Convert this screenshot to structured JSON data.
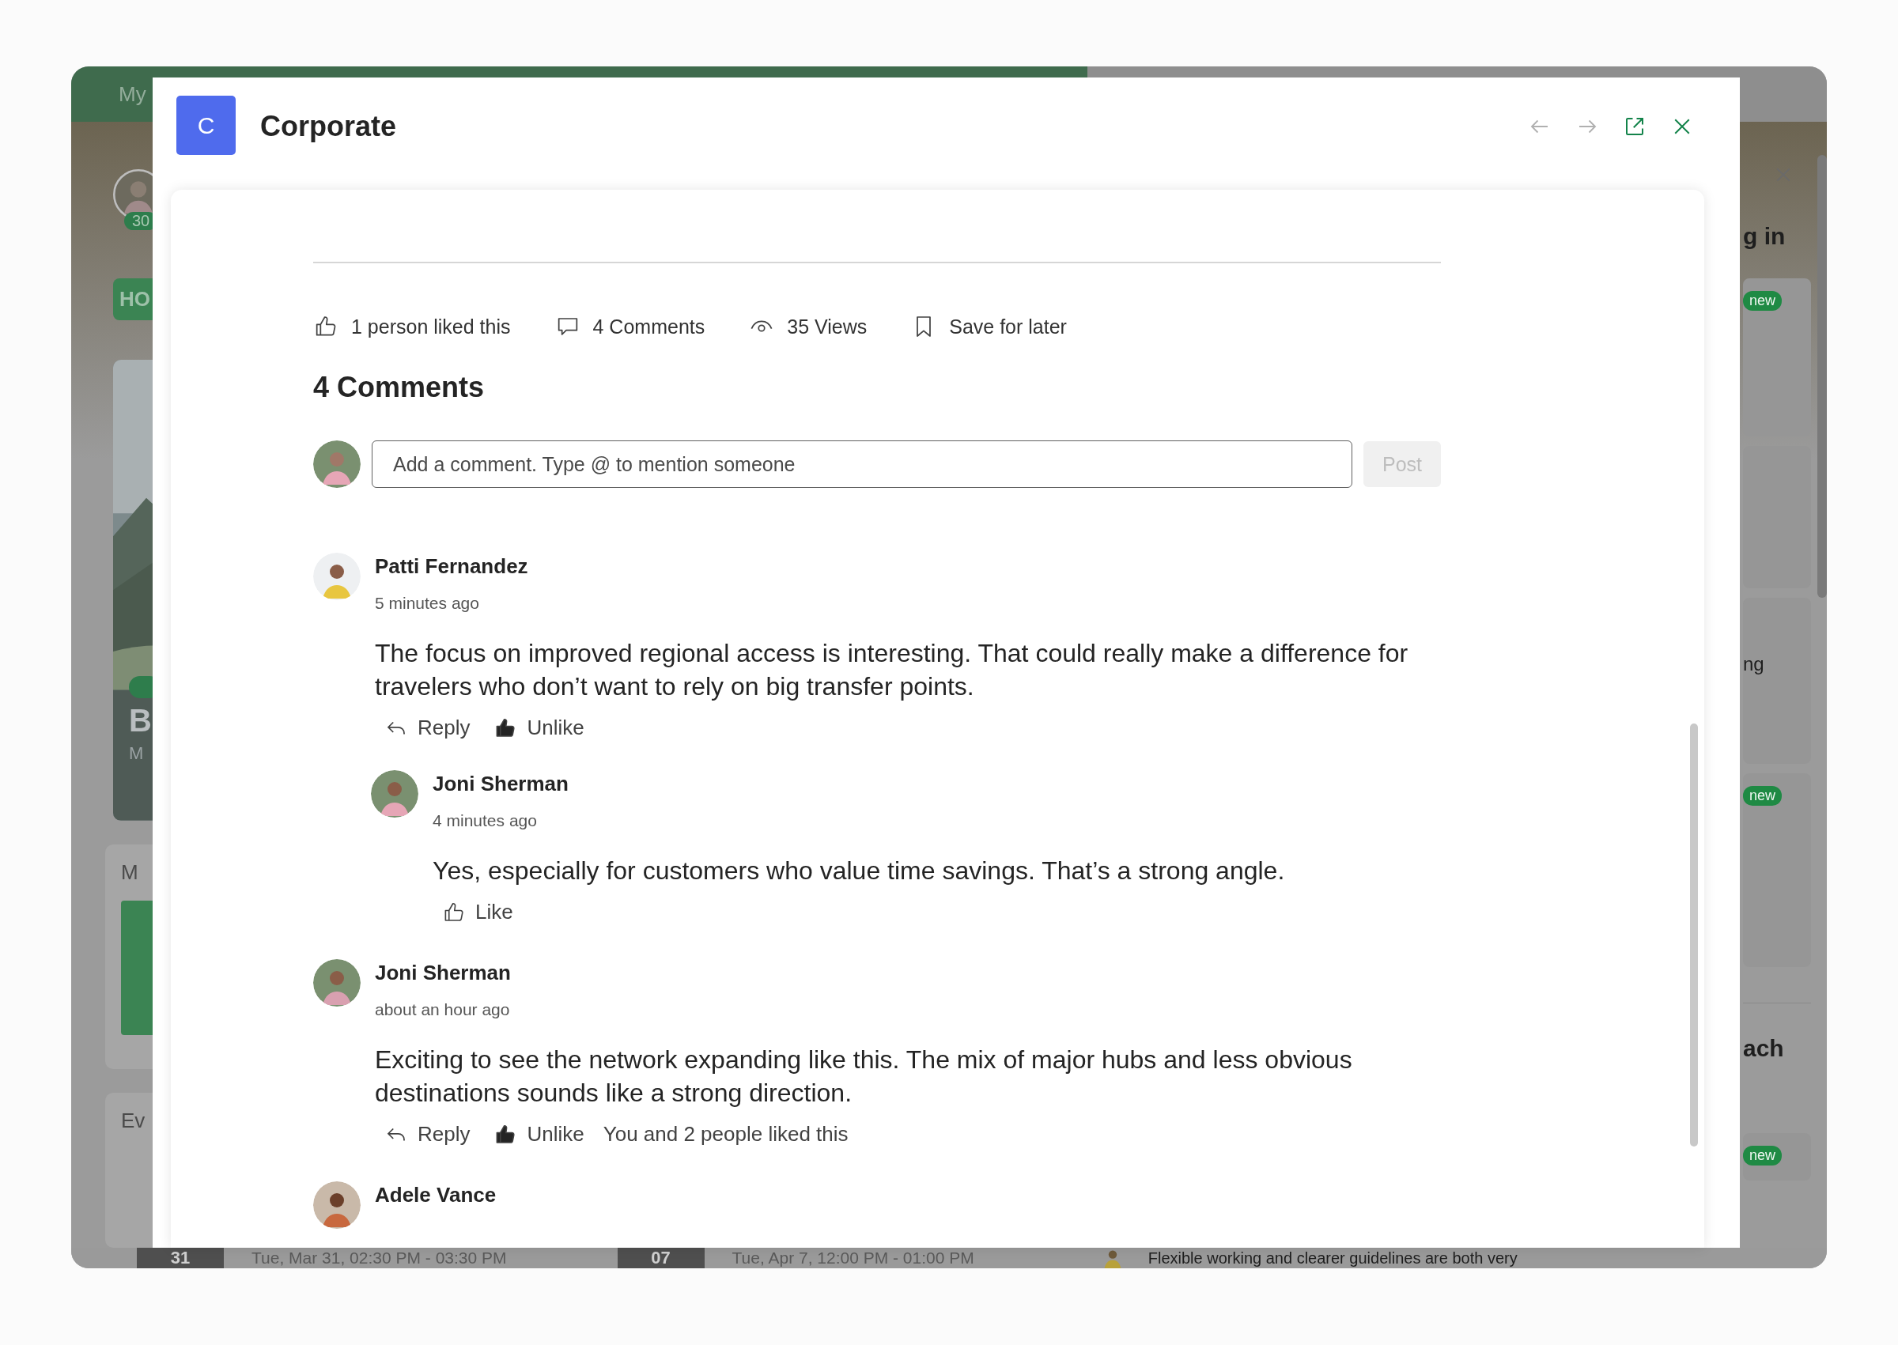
{
  "backdrop": {
    "nav_label": "My",
    "profile_badge": "30",
    "home_button": "HO",
    "hero_title": "B",
    "hero_meta": "M",
    "section_titles": [
      "M",
      "Ev"
    ],
    "right_texts": [
      "g in",
      "ng",
      "ach"
    ],
    "new_badges": [
      "new",
      "new",
      "new"
    ],
    "events": [
      {
        "day": "31",
        "time": "Tue, Mar 31, 02:30 PM - 03:30 PM"
      },
      {
        "day": "07",
        "time": "Tue, Apr 7, 12:00 PM - 01:00 PM"
      }
    ],
    "news_snippet": "Flexible working and clearer guidelines are both very"
  },
  "dialog": {
    "badge": "C",
    "title": "Corporate"
  },
  "stats": [
    {
      "kind": "like",
      "label": "1 person liked this"
    },
    {
      "kind": "comments",
      "label": "4 Comments"
    },
    {
      "kind": "views",
      "label": "35 Views"
    },
    {
      "kind": "save",
      "label": "Save for later"
    }
  ],
  "comments_heading": "4 Comments",
  "comment_box": {
    "placeholder": "Add a comment. Type @ to mention someone",
    "post_label": "Post",
    "post_disabled": true
  },
  "comments": [
    {
      "name": "Patti Fernandez",
      "time": "5 minutes ago",
      "text": "The focus on improved regional access is interesting. That could really make a difference for travelers who don’t want to rely on big transfer points.",
      "reply_label": "Reply",
      "like_label": "Unlike",
      "liked": true,
      "replies": [
        {
          "name": "Joni Sherman",
          "time": "4 minutes ago",
          "text": "Yes, especially for customers who value time savings. That’s a strong angle.",
          "like_label": "Like",
          "liked": false
        }
      ]
    },
    {
      "name": "Joni Sherman",
      "time": "about an hour ago",
      "text": "Exciting to see the network expanding like this. The mix of major hubs and less obvious destinations sounds like a strong direction.",
      "reply_label": "Reply",
      "like_label": "Unlike",
      "liked": true,
      "like_summary": "You and 2 people liked this"
    },
    {
      "name": "Adele Vance"
    }
  ]
}
